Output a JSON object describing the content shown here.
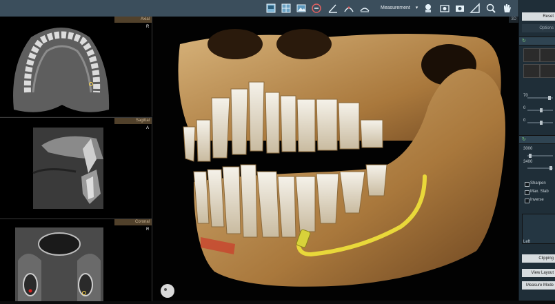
{
  "toolbar": {
    "icons": [
      "layout-icon",
      "grid-layout-icon",
      "image-view-icon",
      "reset-icon",
      "angle-icon",
      "ruler-curve-icon",
      "ruler-arc-icon"
    ],
    "measurement_label": "Measurement",
    "right_icons": [
      "user-view-icon",
      "screenshot-icon",
      "camera-icon",
      "ruler-triangle-icon",
      "zoom-icon",
      "hand-pan-icon"
    ]
  },
  "views": {
    "axial": {
      "label": "Axial",
      "marker": "R"
    },
    "sagittal": {
      "label": "Sagittal",
      "marker": "A"
    },
    "coronal": {
      "label": "Coronal",
      "marker": "R"
    },
    "three_d": {
      "label": "3D"
    }
  },
  "right_panel": {
    "buttons": [
      "Reset",
      "Options"
    ],
    "values": [
      "70",
      "0",
      "0"
    ],
    "range": [
      "3000",
      "3400"
    ],
    "checkboxes": [
      "Sharpen",
      "Max. Slab",
      "Inverse"
    ],
    "list_labels": [
      "Left"
    ],
    "bottom_buttons": [
      "Clipping",
      "View Layout",
      "Measure Mode"
    ]
  },
  "colors": {
    "toolbar": "#3b4e5c",
    "accent": "#ffd84d",
    "bone": "#c8a46a"
  }
}
